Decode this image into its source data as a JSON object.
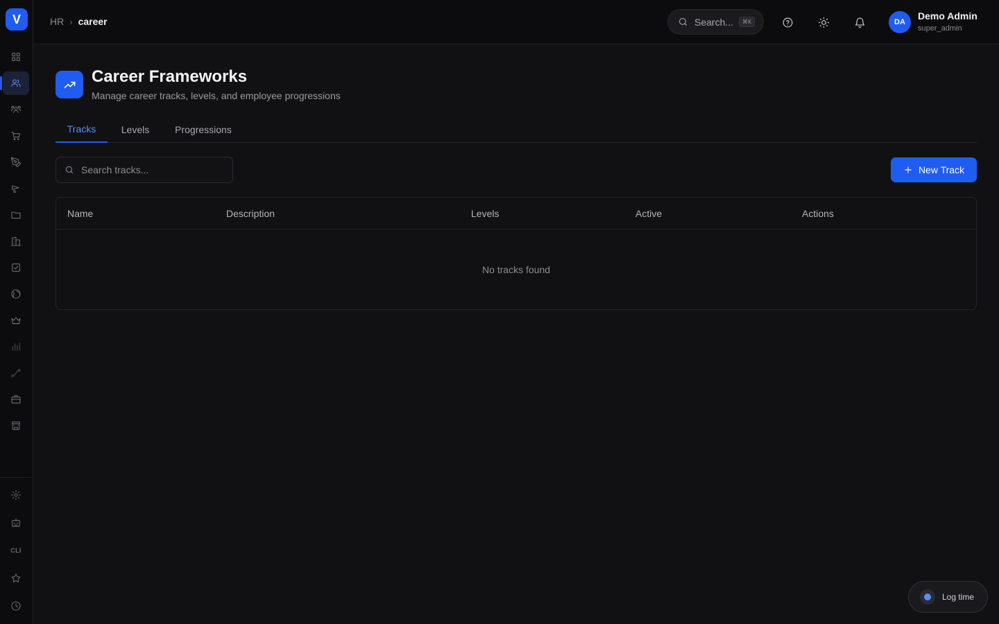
{
  "app": {
    "logo_letter": "V"
  },
  "sidebar": {
    "items": [
      {
        "icon": "dashboard-icon"
      },
      {
        "icon": "users-icon",
        "active": true
      },
      {
        "icon": "team-icon"
      },
      {
        "icon": "cart-icon"
      },
      {
        "icon": "pen-tool-icon"
      },
      {
        "icon": "megaphone-icon"
      },
      {
        "icon": "folder-icon"
      },
      {
        "icon": "building-icon"
      },
      {
        "icon": "check-square-icon"
      },
      {
        "icon": "globe-icon"
      },
      {
        "icon": "crown-icon"
      },
      {
        "icon": "bar-chart-icon"
      },
      {
        "icon": "route-icon"
      },
      {
        "icon": "briefcase-icon"
      },
      {
        "icon": "store-icon"
      }
    ],
    "bottom_items": [
      {
        "icon": "settings-icon"
      },
      {
        "icon": "bot-icon"
      },
      {
        "icon": "cli-icon",
        "label": "CLI"
      },
      {
        "icon": "star-icon"
      },
      {
        "icon": "clock-icon"
      }
    ]
  },
  "header": {
    "breadcrumb": {
      "root": "HR",
      "current": "career"
    },
    "search": {
      "placeholder": "Search...",
      "shortcut": "⌘K"
    },
    "user": {
      "initials": "DA",
      "name": "Demo Admin",
      "role": "super_admin"
    }
  },
  "page": {
    "title": "Career Frameworks",
    "subtitle": "Manage career tracks, levels, and employee progressions",
    "tabs": [
      {
        "label": "Tracks",
        "active": true
      },
      {
        "label": "Levels"
      },
      {
        "label": "Progressions"
      }
    ],
    "search_placeholder": "Search tracks...",
    "new_button_label": "New Track",
    "table": {
      "columns": [
        "Name",
        "Description",
        "Levels",
        "Active",
        "Actions"
      ],
      "empty_text": "No tracks found"
    }
  },
  "log_time": {
    "label": "Log time"
  },
  "colors": {
    "accent": "#1f5cf2",
    "background": "#111113",
    "sidebar": "#0c0c0e"
  }
}
